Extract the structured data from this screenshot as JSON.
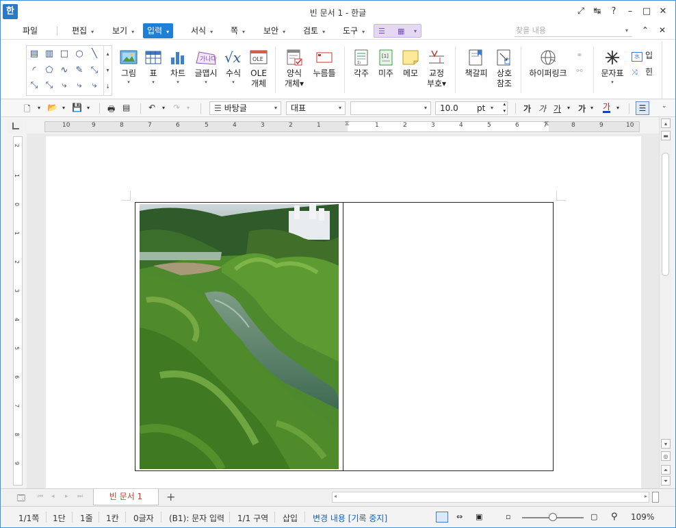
{
  "window": {
    "title": "빈 문서 1 - 한글",
    "logo": "한",
    "controls": [
      "⤢",
      "↹",
      "?",
      "–",
      "□",
      "✕"
    ]
  },
  "menu": {
    "file": "파일",
    "items": [
      "편집",
      "보기",
      "입력",
      "서식",
      "쪽",
      "보안",
      "검토",
      "도구"
    ],
    "active": "입력",
    "search_placeholder": "찾을 내용",
    "collapse": "⌃",
    "close": "✕"
  },
  "ribbon": {
    "buttons": [
      {
        "label": "그림",
        "sub": "▾"
      },
      {
        "label": "표",
        "sub": "▾"
      },
      {
        "label": "차트",
        "sub": "▾"
      },
      {
        "label": "글맵시",
        "sub": "▾"
      },
      {
        "label": "수식",
        "sub": "▾"
      },
      {
        "label": "OLE",
        "sub": "개체"
      },
      {
        "label": "양식",
        "sub": "개체▾"
      },
      {
        "label": "누름틀",
        "sub": ""
      },
      {
        "label": "각주",
        "sub": ""
      },
      {
        "label": "미주",
        "sub": ""
      },
      {
        "label": "메모",
        "sub": ""
      },
      {
        "label": "교정",
        "sub": "부호▾"
      },
      {
        "label": "책갈피",
        "sub": ""
      },
      {
        "label": "상호",
        "sub": "참조"
      },
      {
        "label": "하이퍼링크",
        "sub": ""
      },
      {
        "label": "문자표",
        "sub": "▾"
      }
    ],
    "extra_top": "입",
    "extra_bottom": "힌"
  },
  "toolbar": {
    "style": "바탕글",
    "font": "대표",
    "font_name": "",
    "size": "10.0",
    "unit": "pt",
    "format_icons": [
      "가",
      "가",
      "가",
      "가",
      "가"
    ]
  },
  "ruler": {
    "h_numbers": [
      "10",
      "9",
      "8",
      "7",
      "6",
      "5",
      "4",
      "3",
      "2",
      "1",
      "1",
      "2",
      "3",
      "4",
      "5",
      "6",
      "7",
      "8",
      "9",
      "10"
    ],
    "v_numbers": [
      "2",
      "1",
      "0",
      "1",
      "2",
      "3",
      "4",
      "5",
      "6",
      "7",
      "8",
      "9"
    ]
  },
  "tabs": {
    "document": "빈 문서 1",
    "add": "+"
  },
  "status": {
    "page": "1/1쪽",
    "column": "1단",
    "line": "1줄",
    "col": "1칸",
    "chars": "0글자",
    "cell": "(B1): 문자 입력",
    "section": "1/1 구역",
    "mode": "삽입",
    "track": "변경 내용 [기록 중지]",
    "zoom": "109%"
  }
}
